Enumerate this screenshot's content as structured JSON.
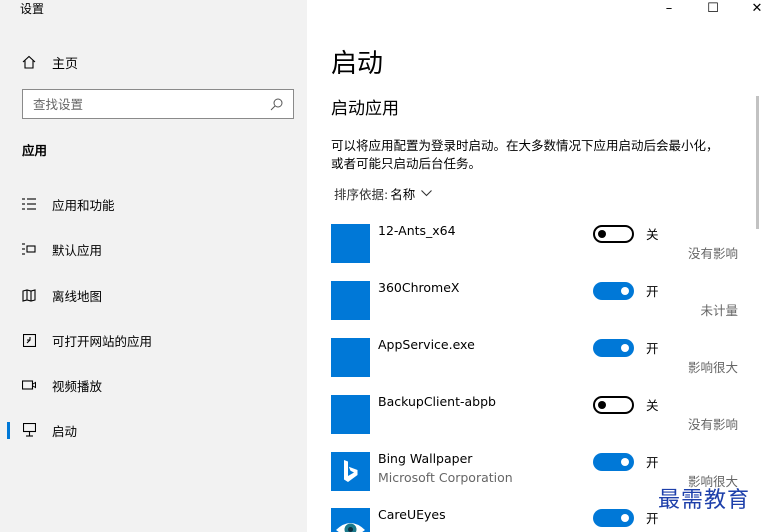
{
  "window": {
    "title": "设置",
    "minimize": "–",
    "maximize": "☐",
    "close": "✕"
  },
  "sidebar": {
    "home_label": "主页",
    "search_placeholder": "查找设置",
    "section_label": "应用",
    "items": [
      {
        "label": "应用和功能",
        "icon": "apps-features-icon"
      },
      {
        "label": "默认应用",
        "icon": "default-apps-icon"
      },
      {
        "label": "离线地图",
        "icon": "offline-maps-icon"
      },
      {
        "label": "可打开网站的应用",
        "icon": "apps-for-websites-icon"
      },
      {
        "label": "视频播放",
        "icon": "video-playback-icon"
      },
      {
        "label": "启动",
        "icon": "startup-icon",
        "active": true
      }
    ]
  },
  "main": {
    "title": "启动",
    "subtitle": "启动应用",
    "description": "可以将应用配置为登录时启动。在大多数情况下应用启动后会最小化，或者可能只启动后台任务。",
    "sort_label": "排序依据:",
    "sort_value": "名称",
    "apps": [
      {
        "name": "12-Ants_x64",
        "publisher": "",
        "enabled": false,
        "state": "关",
        "impact": "没有影响",
        "icon": "generic-app-icon"
      },
      {
        "name": "360ChromeX",
        "publisher": "",
        "enabled": true,
        "state": "开",
        "impact": "未计量",
        "icon": "generic-app-icon"
      },
      {
        "name": "AppService.exe",
        "publisher": "",
        "enabled": true,
        "state": "开",
        "impact": "影响很大",
        "icon": "generic-app-icon"
      },
      {
        "name": "BackupClient-abpb",
        "publisher": "",
        "enabled": false,
        "state": "关",
        "impact": "没有影响",
        "icon": "generic-app-icon"
      },
      {
        "name": "Bing Wallpaper",
        "publisher": "Microsoft Corporation",
        "enabled": true,
        "state": "开",
        "impact": "影响很大",
        "icon": "bing-logo-icon"
      },
      {
        "name": "CareUEyes",
        "publisher": "",
        "enabled": true,
        "state": "开",
        "impact": "",
        "icon": "eye-icon"
      }
    ]
  },
  "watermark": "最需教育",
  "colors": {
    "accent": "#0078d7",
    "sidebar_bg": "#f2f2f2"
  }
}
